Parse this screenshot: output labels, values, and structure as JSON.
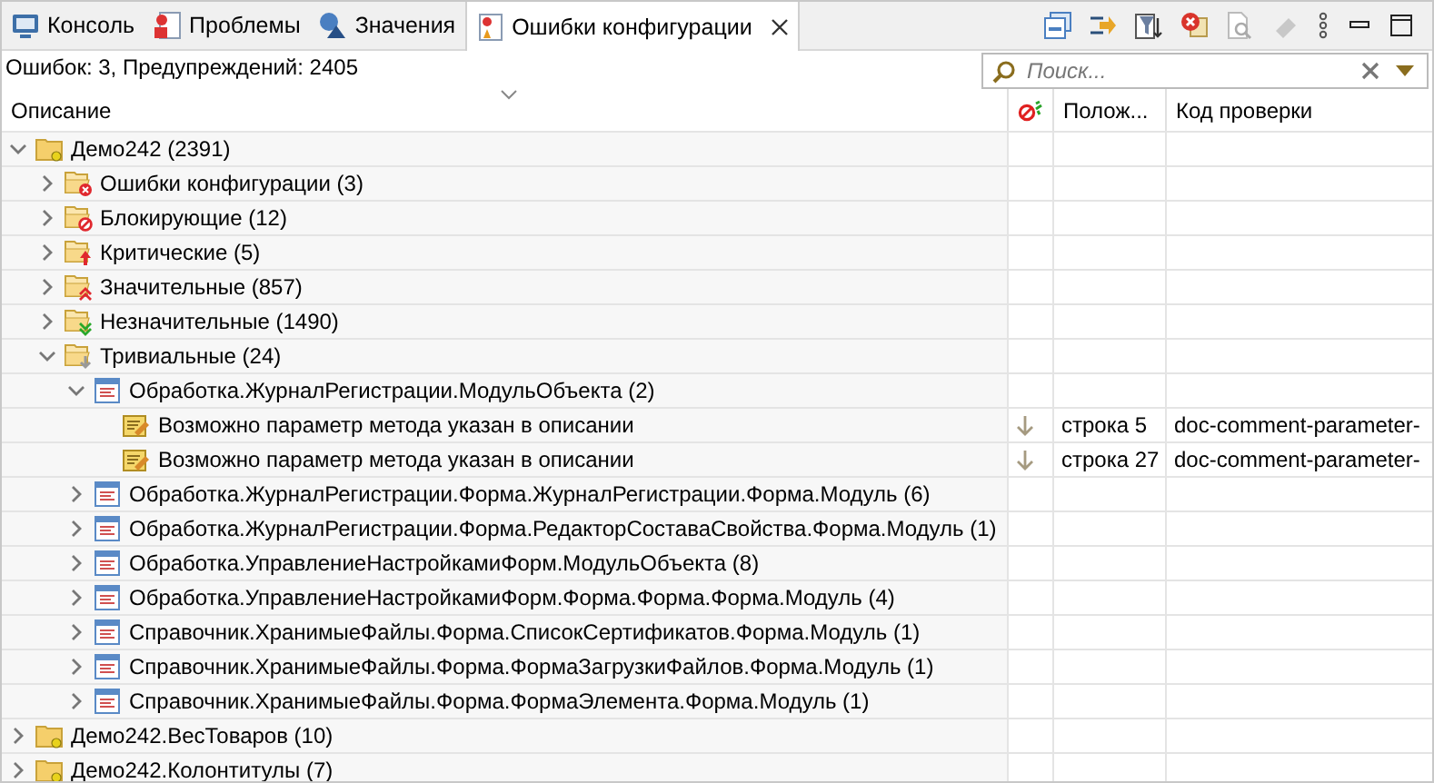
{
  "tabs": [
    {
      "label": "Консоль",
      "kind": "console",
      "selected": false
    },
    {
      "label": "Проблемы",
      "kind": "problems",
      "selected": false
    },
    {
      "label": "Значения",
      "kind": "values",
      "selected": false
    },
    {
      "label": "Ошибки конфигурации",
      "kind": "config",
      "selected": true
    }
  ],
  "summary": "Ошибок: 3, Предупреждений: 2405",
  "search": {
    "placeholder": "Поиск..."
  },
  "columns": [
    "Описание",
    "Полож...",
    "Код проверки"
  ],
  "tree": [
    {
      "label": "Демо242 (2391)",
      "kind": "project",
      "expanded": true,
      "children": [
        {
          "label": "Ошибки конфигурации (3)",
          "kind": "error",
          "expanded": false
        },
        {
          "label": "Блокирующие (12)",
          "kind": "blocker",
          "expanded": false
        },
        {
          "label": "Критические (5)",
          "kind": "critical",
          "expanded": false
        },
        {
          "label": "Значительные (857)",
          "kind": "major",
          "expanded": false
        },
        {
          "label": "Незначительные (1490)",
          "kind": "minor",
          "expanded": false
        },
        {
          "label": "Тривиальные (24)",
          "kind": "trivial",
          "expanded": true,
          "children": [
            {
              "label": "Обработка.ЖурналРегистрации.МодульОбъекта (2)",
              "kind": "module",
              "expanded": true,
              "children": [
                {
                  "label": "Возможно параметр метода указан в описании",
                  "kind": "issue",
                  "position": "строка 5",
                  "check_code": "doc-comment-parameter-"
                },
                {
                  "label": "Возможно параметр метода указан в описании",
                  "kind": "issue",
                  "position": "строка 27",
                  "check_code": "doc-comment-parameter-"
                }
              ]
            },
            {
              "label": "Обработка.ЖурналРегистрации.Форма.ЖурналРегистрации.Форма.Модуль (6)",
              "kind": "module",
              "expanded": false
            },
            {
              "label": "Обработка.ЖурналРегистрации.Форма.РедакторСоставаСвойства.Форма.Модуль (1)",
              "kind": "module",
              "expanded": false
            },
            {
              "label": "Обработка.УправлениеНастройкамиФорм.МодульОбъекта (8)",
              "kind": "module",
              "expanded": false
            },
            {
              "label": "Обработка.УправлениеНастройкамиФорм.Форма.Форма.Форма.Модуль (4)",
              "kind": "module",
              "expanded": false
            },
            {
              "label": "Справочник.ХранимыеФайлы.Форма.СписокСертификатов.Форма.Модуль (1)",
              "kind": "module",
              "expanded": false
            },
            {
              "label": "Справочник.ХранимыеФайлы.Форма.ФормаЗагрузкиФайлов.Форма.Модуль (1)",
              "kind": "module",
              "expanded": false
            },
            {
              "label": "Справочник.ХранимыеФайлы.Форма.ФормаЭлемента.Форма.Модуль (1)",
              "kind": "module",
              "expanded": false
            }
          ]
        }
      ]
    },
    {
      "label": "Демо242.ВесТоваров (10)",
      "kind": "project",
      "expanded": false
    },
    {
      "label": "Демо242.Колонтитулы (7)",
      "kind": "project",
      "expanded": false
    }
  ]
}
